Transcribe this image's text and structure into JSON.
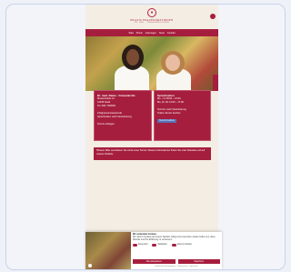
{
  "brand": {
    "mark": "♦",
    "name": "PRAXIS FRAUENÄRZTINNEN",
    "subtitle": "DR. MED. · FRAUENHEILKUNDE"
  },
  "nav": [
    "Start",
    "Praxis",
    "Leistungen",
    "Team",
    "Kontakt"
  ],
  "cards": [
    {
      "title": "Dr. med. Name · Frauenärztin",
      "lines": [
        "Musterstraße 12",
        "12345 Stadt",
        "Tel. 000 / 000000",
        "",
        "info@praxis-beispiel.de",
        "Sprechzeiten nach Vereinbarung"
      ],
      "link": "Termin anfragen"
    },
    {
      "title": "Sprechzeiten",
      "lines": [
        "Mo – Fr  08:00 – 12:00",
        "Mo, Di, Do  14:00 – 17:00",
        "",
        "Termine nach Vereinbarung",
        "Online-Termin buchen"
      ],
      "link": "Termin buchen"
    }
  ],
  "notice": "Hinweis: Bitte vereinbaren Sie vorab einen Termin. Weitere Informationen finden Sie unter Aktuelles und auf unserer Website.",
  "cookie": {
    "title": "Wir verwenden Cookies",
    "text": "Wir nutzen Cookies auf unserer Website. Einige sind essenziell, andere helfen uns, diese Website und Ihre Erfahrung zu verbessern.",
    "toggles": [
      "Essenziell",
      "Statistiken",
      "Externe Medien"
    ],
    "accept": "Alle akzeptieren",
    "save": "Speichern",
    "links": "Individuelle Einstellungen · Datenschutz · Impressum"
  },
  "colors": {
    "accent": "#a61e3e",
    "background": "#f3ede3"
  }
}
